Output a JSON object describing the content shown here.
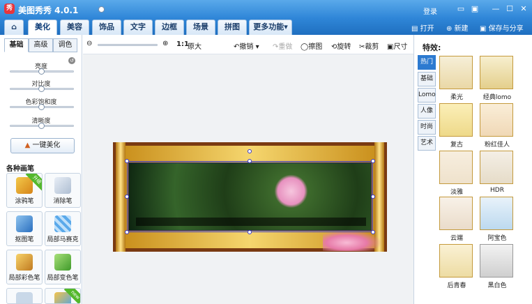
{
  "window": {
    "title": "美图秀秀 4.0.1",
    "login": "登录",
    "logo_text": "秀"
  },
  "nav": {
    "tabs": [
      "美化",
      "美容",
      "饰品",
      "文字",
      "边框",
      "场景",
      "拼图",
      "更多功能"
    ],
    "more_arrow": "▾",
    "actions": {
      "open": "打开",
      "new": "新建",
      "save_share": "保存与分享"
    }
  },
  "left": {
    "subtabs": [
      "基础",
      "高级",
      "调色"
    ],
    "sliders": [
      {
        "label": "亮度",
        "value": 50
      },
      {
        "label": "对比度",
        "value": 50
      },
      {
        "label": "色彩饱和度",
        "value": 50
      },
      {
        "label": "清晰度",
        "value": 50
      }
    ],
    "one_key": "一键美化",
    "brush_title": "各种画笔",
    "brushes": [
      "涂鸦笔",
      "消除笔",
      "抠图笔",
      "局部马赛克",
      "局部彩色笔",
      "局部变色笔"
    ],
    "badge_new": "new",
    "badge_upgrade": "升级"
  },
  "toolbar": {
    "zoom_value": 10,
    "ratio": "1:1",
    "original": "原大",
    "undo": "撤销",
    "redo": "重做",
    "eraser": "擦图",
    "rotate": "旋转",
    "crop": "裁剪",
    "size": "尺寸"
  },
  "right": {
    "title": "特效:",
    "categories": [
      "热门",
      "基础",
      "Lomo",
      "人像",
      "时尚",
      "艺术"
    ],
    "effects": [
      "柔光",
      "经典lomo",
      "复古",
      "粉红佳人",
      "淡雅",
      "HDR",
      "云端",
      "阿宝色",
      "后青春",
      "黑白色"
    ]
  },
  "colors": {
    "titlebar": "#2f86d8",
    "accent": "#2c7ad0",
    "new_badge": "#54b82c"
  }
}
